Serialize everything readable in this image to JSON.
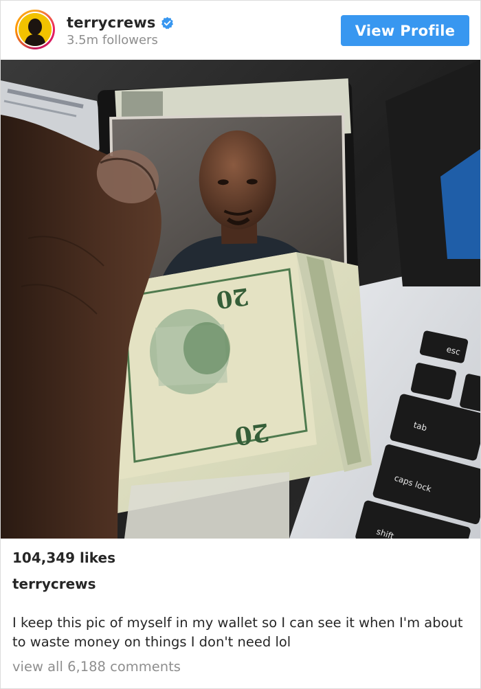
{
  "post": {
    "username": "terrycrews",
    "followers": "3.5m followers",
    "view_profile_label": "View Profile",
    "verified": true,
    "likes": "104,349 likes",
    "caption_user": "terrycrews",
    "caption": "I keep this pic of myself in my wallet so I can see it when I'm about to waste money on things I don't need lol",
    "view_comments": "view all 6,188 comments"
  },
  "photo": {
    "banknote_label": "20",
    "keyboard_keys": [
      "esc",
      "tab",
      "caps lock",
      "shift"
    ]
  },
  "icons": {
    "verified": "verified-badge-icon",
    "avatar": "profile-avatar"
  },
  "colors": {
    "button": "#3897f0",
    "verified": "#3897f0",
    "text": "#262626",
    "muted": "#8e8e8e"
  }
}
